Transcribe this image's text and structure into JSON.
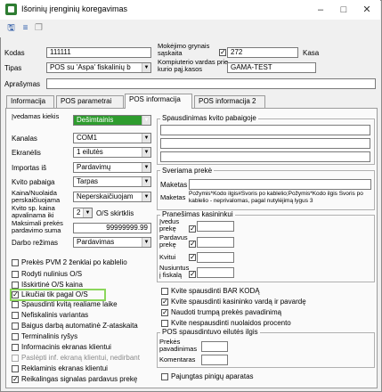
{
  "window": {
    "title": "Išorinių įrenginių koregavimas",
    "min": "–",
    "max": "□",
    "close": "✕"
  },
  "toolbar": {
    "icons": [
      "save-icon",
      "tree-icon",
      "copy-icon"
    ]
  },
  "header": {
    "kodas_label": "Kodas",
    "kodas_value": "111111",
    "tipas_label": "Tipas",
    "tipas_value": "POS su 'Aspa' fiskalinių b",
    "aprasymas_label": "Aprašymas",
    "aprasymas_value": "",
    "kas_label": "Mokėjimo grynais sąskaita",
    "kas_value": "272",
    "kas_suffix": "Kasa",
    "komp_label": "Kompiuterio vardas prie kurio pąj.kasos",
    "komp_value": "GAMA-TEST"
  },
  "tabs": [
    "Informacija",
    "POS parametrai",
    "POS informacija",
    "POS informacija 2"
  ],
  "active_tab": "POS informacija",
  "left_form": [
    {
      "label": "Įvedamas kiekis",
      "value": "Dešimtainis",
      "highlight": true
    },
    {
      "label": "Kanalas",
      "value": "COM1"
    },
    {
      "label": "Ekranėlis",
      "value": "1 eilutės"
    },
    {
      "label": "Importas iš",
      "value": "Pardavimų"
    },
    {
      "label": "Kvito pabaiga",
      "value": "Tarpas"
    },
    {
      "label": "Kaina/Nuolaida perskaičiuojama",
      "value": "Neperskaičiuojam"
    },
    {
      "label": "Kvito sp. kaina apvalinama iki",
      "value": "2",
      "suffix": "O/S skirtklis"
    },
    {
      "label": "Maksimali prekės pardavimo suma",
      "value": "99999999.99"
    },
    {
      "label": "Darbo režimas",
      "value": "Pardavimas"
    }
  ],
  "checkboxes": [
    {
      "label": "Prekės PVM 2 ženklai po kablelio",
      "checked": false,
      "disabled": false
    },
    {
      "label": "Rodyti nulinius O/S",
      "checked": false,
      "disabled": false
    },
    {
      "label": "Išskirtinė O/S kaina",
      "checked": false,
      "disabled": false
    },
    {
      "label": "Likučiai tik pagal O/S",
      "checked": true,
      "disabled": false
    },
    {
      "label": "Spausdinti kvitą realiame laike",
      "checked": false,
      "disabled": false
    },
    {
      "label": "Nefiskalinis variantas",
      "checked": false,
      "disabled": false
    },
    {
      "label": "Baigus darbą automatinė Z-ataskaita",
      "checked": false,
      "disabled": false
    },
    {
      "label": "Terminalinis ryšys",
      "checked": false,
      "disabled": false
    },
    {
      "label": "Informacinis ekranas klientui",
      "checked": false,
      "disabled": false
    },
    {
      "label": "Paslėpti inf. ekraną klientui, nedirbant",
      "checked": false,
      "disabled": true
    },
    {
      "label": "Reklaminis ekranas klientui",
      "checked": false,
      "disabled": false
    },
    {
      "label": "Reikalingas signalas pardavus prekę",
      "checked": true,
      "disabled": false
    }
  ],
  "right": {
    "spausd_title": "Spausdinimas kvito pabaigoje",
    "sveriama_title": "Sveriama prekė",
    "maketas_label": "Maketas",
    "maketas_info_label": "Maketas",
    "maketas_info": "Požymis*Kodo ilgis#Svoris po kablelio;Požymis*Kodo ilgis Svoris po kablelio - neprivalomas, pagal nutylėjimą lygus 3",
    "kasinink_title": "Pranešimas kasininkui",
    "kasinink_rows": [
      "Įvedus prekę",
      "Pardavus prekę",
      "Kvitui",
      "Nusiuntus į fiskalą"
    ],
    "checks": [
      {
        "label": "Kvite spausdinti BAR KODĄ",
        "checked": false
      },
      {
        "label": "Kvite spausdinti kasininko vardą ir pavardę",
        "checked": true
      },
      {
        "label": "Naudoti trumpą prekės pavadinimą",
        "checked": true
      },
      {
        "label": "Kvite nespausdinti nuolaidos procento",
        "checked": false
      }
    ],
    "eilutes_title": "POS spausdintuvo eilutės ilgis",
    "eilutes_rows": [
      "Prekės pavadinimas",
      "Komentaras"
    ],
    "pajungtas_label": "Pajungtas pinigų aparatas",
    "pajungtas_checked": false
  },
  "colors": {
    "highlight_green": "#2e9c2e",
    "annotation_green": "#8bd65c"
  }
}
